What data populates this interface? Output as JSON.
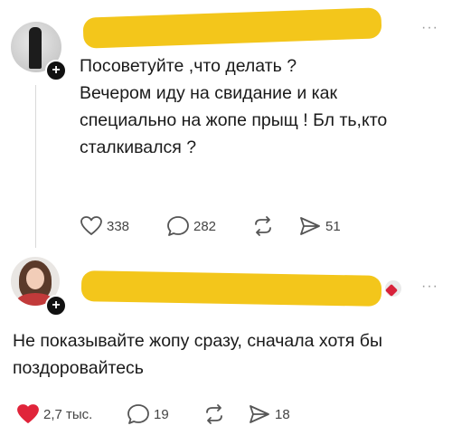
{
  "posts": [
    {
      "text_lines": [
        "Посоветуйте ,что делать ?",
        "Вечером иду на свидание и как",
        "специально на жопе прыщ ! Бл   ть,кто",
        "сталкивался ?"
      ],
      "likes": "338",
      "replies": "282",
      "shares": "51",
      "liked": false
    },
    {
      "text_lines": [
        "Не показывайте жопу сразу, сначала хотя бы",
        "поздоровайтесь"
      ],
      "likes": "2,7 тыс.",
      "replies": "19",
      "shares": "18",
      "liked": true
    }
  ],
  "icons": {
    "like": "heart-icon",
    "reply": "speech-bubble-icon",
    "repost": "repost-arrows-icon",
    "share": "paper-plane-icon",
    "follow": "plus-icon",
    "more": "ellipsis-icon"
  },
  "colors": {
    "liked": "#e0243a",
    "redaction": "#f3c61b",
    "icon": "#555555"
  }
}
